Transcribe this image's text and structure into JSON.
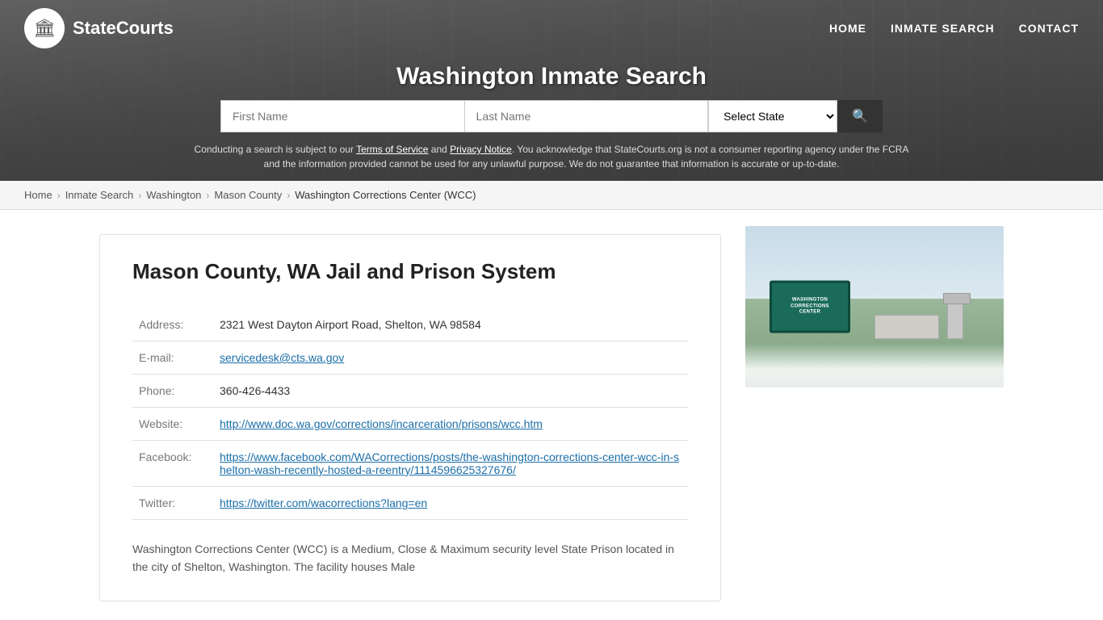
{
  "site": {
    "name": "StateCourts"
  },
  "nav": {
    "home": "HOME",
    "inmate_search": "INMATE SEARCH",
    "contact": "CONTACT"
  },
  "header": {
    "title": "Washington Inmate Search"
  },
  "search": {
    "first_name_placeholder": "First Name",
    "last_name_placeholder": "Last Name",
    "state_placeholder": "Select State",
    "button_icon": "🔍"
  },
  "disclaimer": {
    "text_before": "Conducting a search is subject to our ",
    "terms_label": "Terms of Service",
    "text_mid": " and ",
    "privacy_label": "Privacy Notice",
    "text_after": ". You acknowledge that StateCourts.org is not a consumer reporting agency under the FCRA and the information provided cannot be used for any unlawful purpose. We do not guarantee that information is accurate or up-to-date."
  },
  "breadcrumb": {
    "home": "Home",
    "inmate_search": "Inmate Search",
    "state": "Washington",
    "county": "Mason County",
    "current": "Washington Corrections Center (WCC)"
  },
  "page": {
    "title": "Mason County, WA Jail and Prison System",
    "address_label": "Address:",
    "address_value": "2321 West Dayton Airport Road, Shelton, WA 98584",
    "email_label": "E-mail:",
    "email_value": "servicedesk@cts.wa.gov",
    "phone_label": "Phone:",
    "phone_value": "360-426-4433",
    "website_label": "Website:",
    "website_value": "http://www.doc.wa.gov/corrections/incarceration/prisons/wcc.htm",
    "website_display": "http://www.doc.wa.gov/corrections/incarceration/prisons/wcc.htm",
    "facebook_label": "Facebook:",
    "facebook_value": "https://www.facebook.com/WACorrections/posts/the-washington-corrections-center-wcc-in-shelton-wash-recently-hosted-a-reentry/1114596625327676/",
    "facebook_display": "https://www.facebook.com/WACorrections/posts/the-washington-corrections-center-wcc-in-shelton-wash-recently-hosted-a-reentry/1114596625327676/",
    "twitter_label": "Twitter:",
    "twitter_value": "https://twitter.com/wacorrections?lang=en",
    "twitter_display": "https://twitter.com/wacorrections?lang=en",
    "description": "Washington Corrections Center (WCC) is a Medium, Close & Maximum security level State Prison located in the city of Shelton, Washington. The facility houses Male",
    "facility_sign_line1": "WASHINGTON",
    "facility_sign_line2": "CORRECTIONS",
    "facility_sign_line3": "CENTER"
  }
}
